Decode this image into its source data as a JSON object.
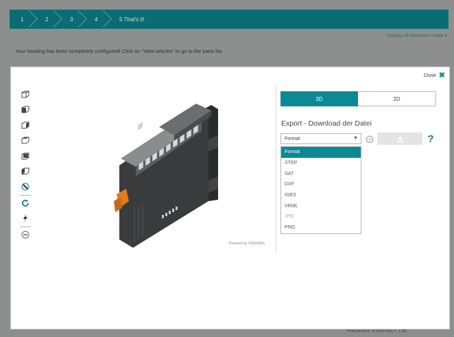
{
  "steps": [
    {
      "label": "1"
    },
    {
      "label": "2"
    },
    {
      "label": "3"
    },
    {
      "label": "4"
    },
    {
      "label": "5 That's it!"
    }
  ],
  "display_all_label": "Display all decisions made ▾",
  "configured_message": "Your housing has been completely configured! Click on \"View articles\" to go to the parts list.",
  "company_footer": "PHOENIX CONTACT Ltd",
  "modal": {
    "close_label": "Close",
    "close_icon": "close-icon",
    "powered_by": "Powered by CADENAS",
    "toolbar_icons": [
      "view-iso-front-icon",
      "view-front-icon",
      "view-right-icon",
      "view-top-icon",
      "view-back-icon",
      "view-left-icon",
      "view-bottom-icon",
      "rotate-icon",
      "flash-icon",
      "zoom-fit-icon"
    ],
    "tabs": [
      {
        "label": "3D",
        "active": true
      },
      {
        "label": "2D",
        "active": false
      }
    ],
    "export_title": "Export - Download der Datei",
    "format_select": {
      "value": "Format"
    },
    "format_options": [
      {
        "label": "Format",
        "state": "selected"
      },
      {
        "label": "STEP",
        "state": "normal"
      },
      {
        "label": "SAT",
        "state": "normal"
      },
      {
        "label": "DXF",
        "state": "normal"
      },
      {
        "label": "IGES",
        "state": "normal"
      },
      {
        "label": "VRML",
        "state": "normal"
      },
      {
        "label": "JPG",
        "state": "disabled"
      },
      {
        "label": "PNG",
        "state": "normal"
      }
    ],
    "help_label": "?",
    "accent_color": "#0b8a96"
  }
}
